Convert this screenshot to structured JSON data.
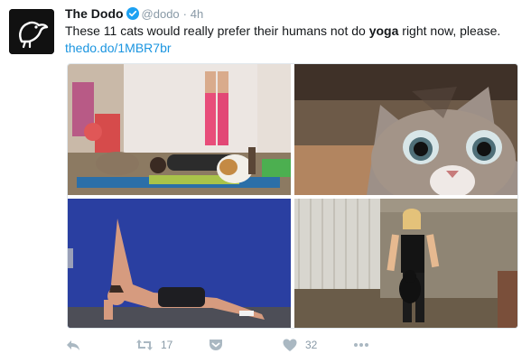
{
  "account": {
    "name": "The Dodo",
    "handle": "@dodo",
    "separator": "·",
    "time": "4h",
    "verified_color": "#1da1f2"
  },
  "tweet": {
    "text_before": "These 11 cats would really prefer their humans not do ",
    "text_bold": "yoga",
    "text_after": " right now, please.",
    "link": "thedo.do/1MBR7br",
    "link_color": "#1b95e0"
  },
  "media": {
    "photos": [
      {
        "name": "photo-yoga-legs-up-cat"
      },
      {
        "name": "photo-cat-closeup"
      },
      {
        "name": "photo-side-plank"
      },
      {
        "name": "photo-woman-with-cat"
      }
    ]
  },
  "actions": {
    "reply_icon": "reply-icon",
    "retweet_icon": "retweet-icon",
    "retweet_count": "17",
    "pocket_icon": "pocket-icon",
    "like_icon": "heart-icon",
    "like_count": "32",
    "more_icon": "more-icon"
  }
}
